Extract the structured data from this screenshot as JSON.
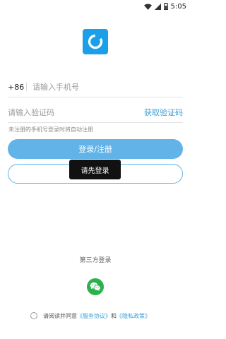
{
  "status_bar": {
    "time": "5:05",
    "icons": [
      "wifi-icon",
      "signal-icon",
      "battery-icon"
    ]
  },
  "logo": {
    "icon": "app-logo-ring"
  },
  "phone": {
    "country_code": "+86",
    "placeholder": "请输入手机号"
  },
  "code": {
    "placeholder": "请输入验证码",
    "get_code_label": "获取验证码"
  },
  "hint": "未注册的手机号登录时将自动注册",
  "buttons": {
    "login_label": "登录/注册",
    "secondary_label": ""
  },
  "toast": "请先登录",
  "third_party": {
    "title": "第三方登录",
    "wechat_icon": "wechat-icon"
  },
  "agreement": {
    "prefix": "请阅读并同意",
    "service_link": "《服务协议》",
    "conjunction": "和",
    "privacy_link": "《隐私政策》"
  },
  "colors": {
    "accent": "#62b4e8",
    "link": "#3a9fd8",
    "logo_bg": "#1a9fe8",
    "wechat": "#2bb24c"
  }
}
